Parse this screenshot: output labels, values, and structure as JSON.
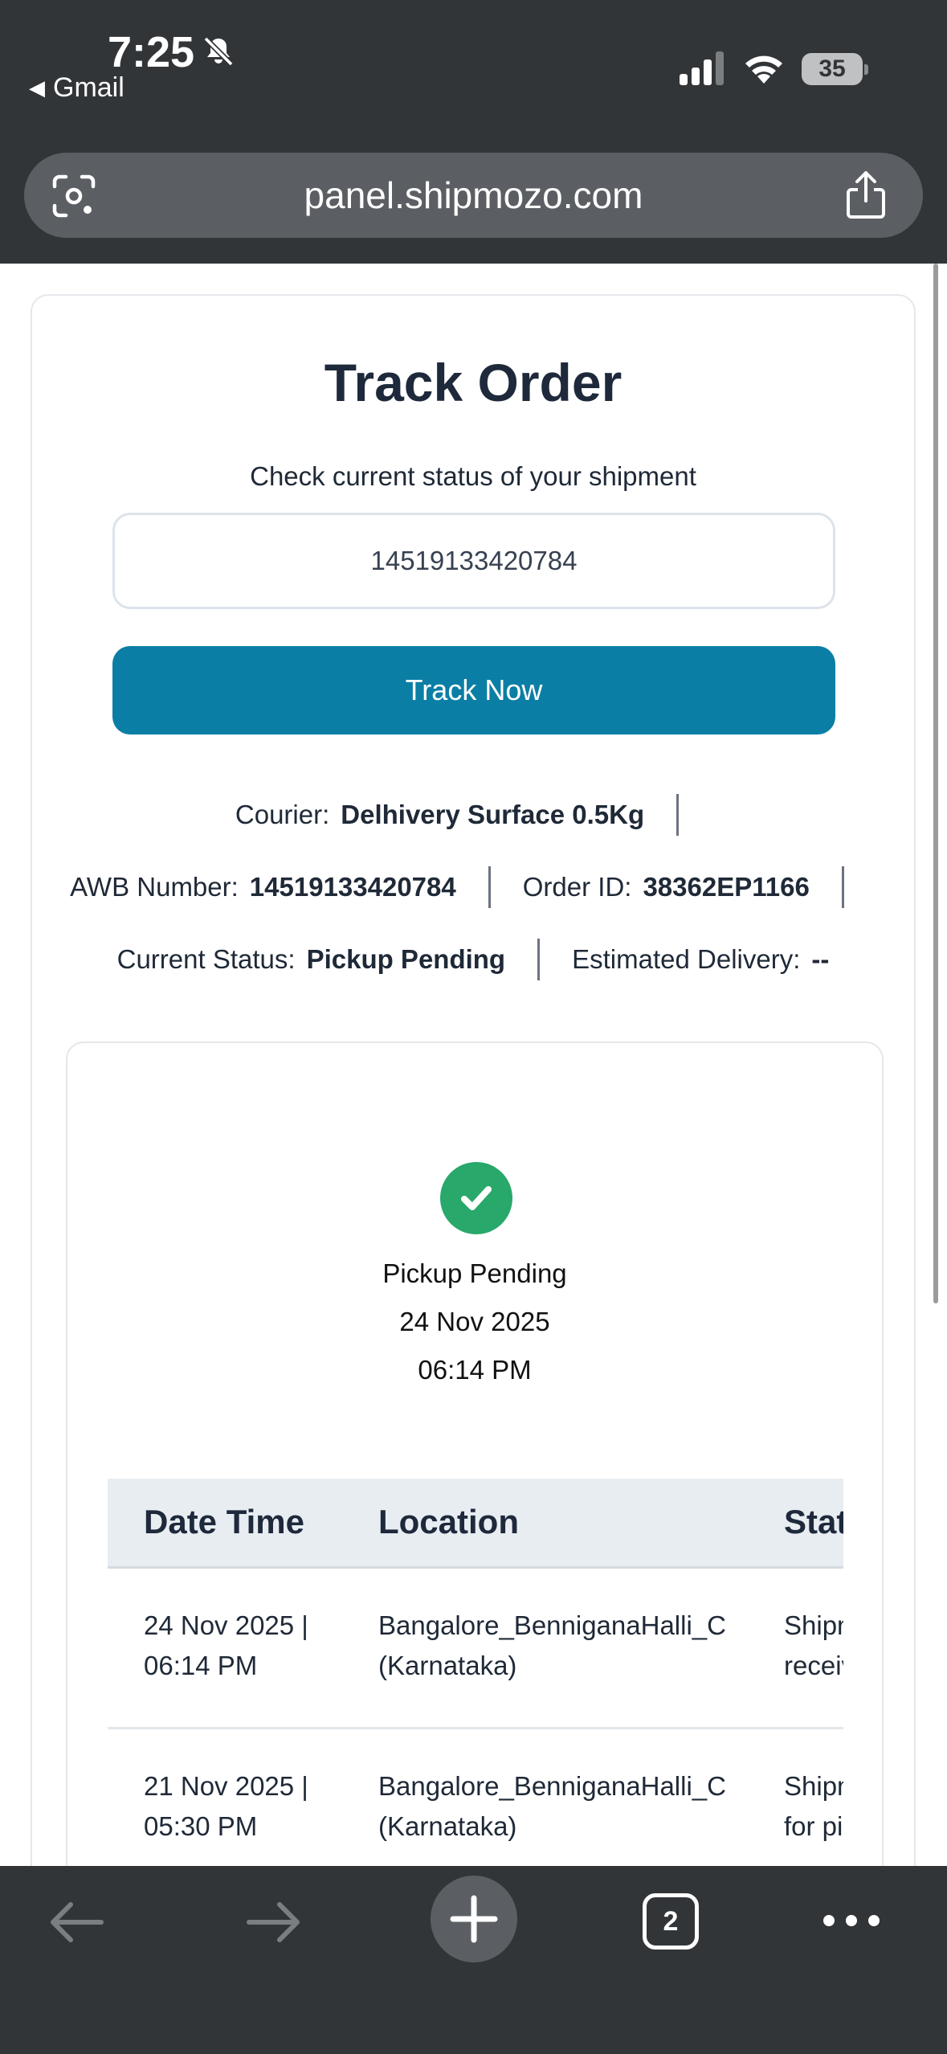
{
  "status_bar": {
    "time": "7:25",
    "back_app": "Gmail",
    "battery": "35"
  },
  "browser": {
    "url": "panel.shipmozo.com",
    "tab_count": "2"
  },
  "page": {
    "title": "Track Order",
    "subtitle": "Check current status of your shipment",
    "awb_input_value": "14519133420784",
    "track_button": "Track Now",
    "courier_label": "Courier:",
    "courier_value": "Delhivery Surface 0.5Kg",
    "awb_label": "AWB Number:",
    "awb_value": "14519133420784",
    "order_label": "Order ID:",
    "order_value": "38362EP1166",
    "status_label": "Current Status:",
    "status_value": "Pickup Pending",
    "delivery_label": "Estimated Delivery:",
    "delivery_value": "--"
  },
  "latest_event": {
    "status": "Pickup Pending",
    "date": "24 Nov 2025",
    "time": "06:14 PM"
  },
  "history_table": {
    "headers": [
      "Date Time",
      "Location",
      "Stat"
    ],
    "rows": [
      {
        "date_line1": "24 Nov 2025 |",
        "date_line2": "06:14 PM",
        "loc_line1": "Bangalore_BenniganaHalli_C",
        "loc_line2": "(Karnataka)",
        "status_line1": "Shipm",
        "status_line2": "receiv"
      },
      {
        "date_line1": "21 Nov 2025 |",
        "date_line2": "05:30 PM",
        "loc_line1": "Bangalore_BenniganaHalli_C",
        "loc_line2": "(Karnataka)",
        "status_line1": "Shipm",
        "status_line2": "for pic"
      }
    ]
  },
  "colors": {
    "accent": "#0b7ea5",
    "success": "#28a86a",
    "chrome": "#323538"
  }
}
